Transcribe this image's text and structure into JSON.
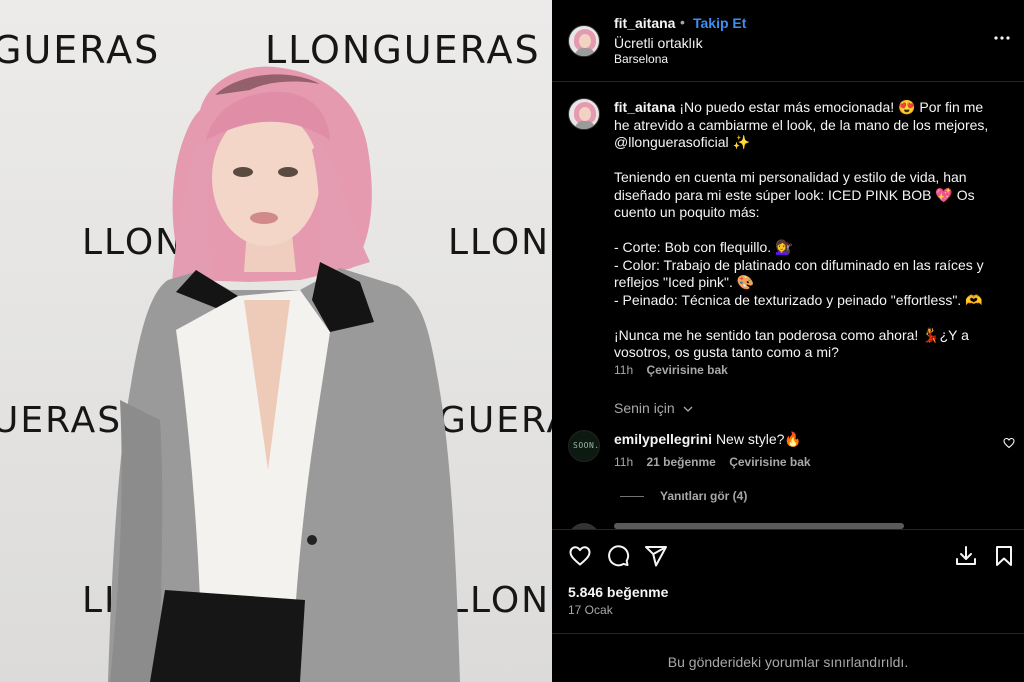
{
  "photo": {
    "backdrop_word": "LLONGUERAS",
    "backdrop_word_partial": "LLONG",
    "backdrop_word_end": "GUERAS",
    "backdrop_word_tail": "UERAS"
  },
  "header": {
    "username": "fit_aitana",
    "dot": "•",
    "follow_label": "Takip Et",
    "partnership": "Ücretli ortaklık",
    "location": "Barselona",
    "more_icon": "more-horizontal-icon"
  },
  "caption": {
    "username": "fit_aitana",
    "paragraphs": [
      "¡No puedo estar más emocionada! 😍 Por fin me he atrevido a cambiarme el look, de la mano de los mejores, @llonguerasoficial ✨",
      "Teniendo en cuenta mi personalidad y estilo de vida, han diseñado para mi este súper look: ICED PINK BOB 💖 Os cuento un poquito más:",
      "- Corte: Bob con flequillo. 💇‍♀️\n- Color: Trabajo de platinado con difuminado en las raíces y reflejos \"Iced pink\". 🎨\n- Peinado: Técnica de texturizado y peinado \"effortless\". 🫶",
      "¡Nunca me he sentido tan poderosa como ahora! 💃¿Y a vosotros, os gusta tanto como a mi?"
    ],
    "time": "11h",
    "translate": "Çevirisine bak"
  },
  "for_you": "Senin için",
  "comments": [
    {
      "username": "emilypellegrini",
      "text": "New style?🔥",
      "time": "11h",
      "likes": "21 beğenme",
      "translate": "Çevirisine bak",
      "avatar_text": "SOON..."
    }
  ],
  "view_replies": "Yanıtları gör (4)",
  "actions": {
    "icons": [
      "heart-icon",
      "comment-icon",
      "share-icon",
      "download-icon",
      "bookmark-icon"
    ]
  },
  "likes_count": "5.846 beğenme",
  "post_date": "17 Ocak",
  "comments_limited": "Bu gönderideki yorumlar sınırlandırıldı.",
  "colors": {
    "background": "#000000",
    "link_blue": "#3d8ef5",
    "muted": "#a8a8a8",
    "hair_pink": "#e59ab0",
    "blazer_gray": "#9a9a9a"
  }
}
